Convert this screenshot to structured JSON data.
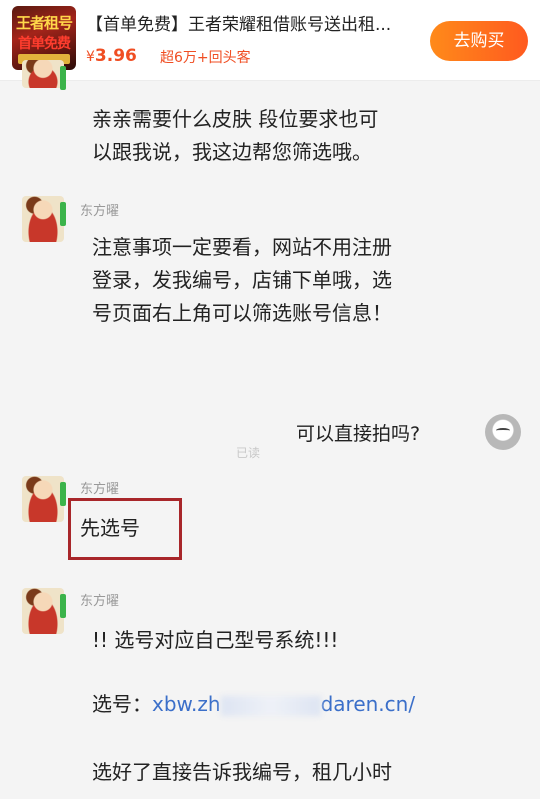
{
  "product": {
    "thumb_line1": "王者租号",
    "thumb_line2": "首单免费",
    "title": "【首单免费】王者荣耀租借账号送出租...",
    "price_symbol": "¥",
    "price": "3.96",
    "sold_text": "超6万+回头客",
    "buy_label": "去购买"
  },
  "chat": {
    "sender_name": "东方曜",
    "msg_top_l1": "亲亲需要什么皮肤 段位要求也可",
    "msg_top_l2": "以跟我说，我这边帮您筛选哦。",
    "msg2_l1": "注意事项一定要看，网站不用注册",
    "msg2_l2": "登录，发我编号，店铺下单哦，选",
    "msg2_l3": "号页面右上角可以筛选账号信息！",
    "user_msg": "可以直接拍吗?",
    "read_label": "已读",
    "msg3": "先选号",
    "msg4_l1": "!! 选号对应自己型号系统!!!",
    "msg4_label": "选号：",
    "msg4_link_start": "xbw.zh",
    "msg4_link_end": "daren.cn/",
    "msg4_l3": "选好了直接告诉我编号，租几小时"
  },
  "colors": {
    "accent": "#f04e23",
    "buy_gradient_start": "#ff8a1a",
    "buy_gradient_end": "#ff5a1f",
    "link": "#3b6fc9",
    "highlight_box": "#a8262a"
  }
}
